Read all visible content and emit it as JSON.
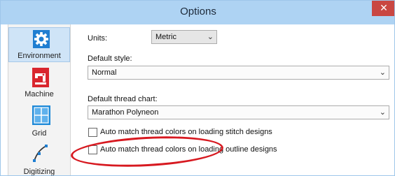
{
  "window": {
    "title": "Options",
    "close_glyph": "✕"
  },
  "sidebar": {
    "items": [
      {
        "label": "Environment",
        "icon": "gear-icon",
        "selected": true
      },
      {
        "label": "Machine",
        "icon": "sewing-machine-icon",
        "selected": false
      },
      {
        "label": "Grid",
        "icon": "grid-icon",
        "selected": false
      },
      {
        "label": "Digitizing",
        "icon": "digitizing-icon",
        "selected": false
      }
    ]
  },
  "settings": {
    "units_label": "Units:",
    "units_value": "Metric",
    "default_style_label": "Default style:",
    "default_style_value": "Normal",
    "thread_chart_label": "Default thread chart:",
    "thread_chart_value": "Marathon Polyneon",
    "auto_match_stitch_label": "Auto match thread colors on loading stitch designs",
    "auto_match_stitch_checked": false,
    "auto_match_outline_label": "Auto match thread colors on loading outline designs",
    "auto_match_outline_checked": false
  },
  "colors": {
    "titlebar": "#aed3f3",
    "selected_nav": "#cfe4f7",
    "annotation": "#d71920",
    "close_button": "#c94742"
  }
}
